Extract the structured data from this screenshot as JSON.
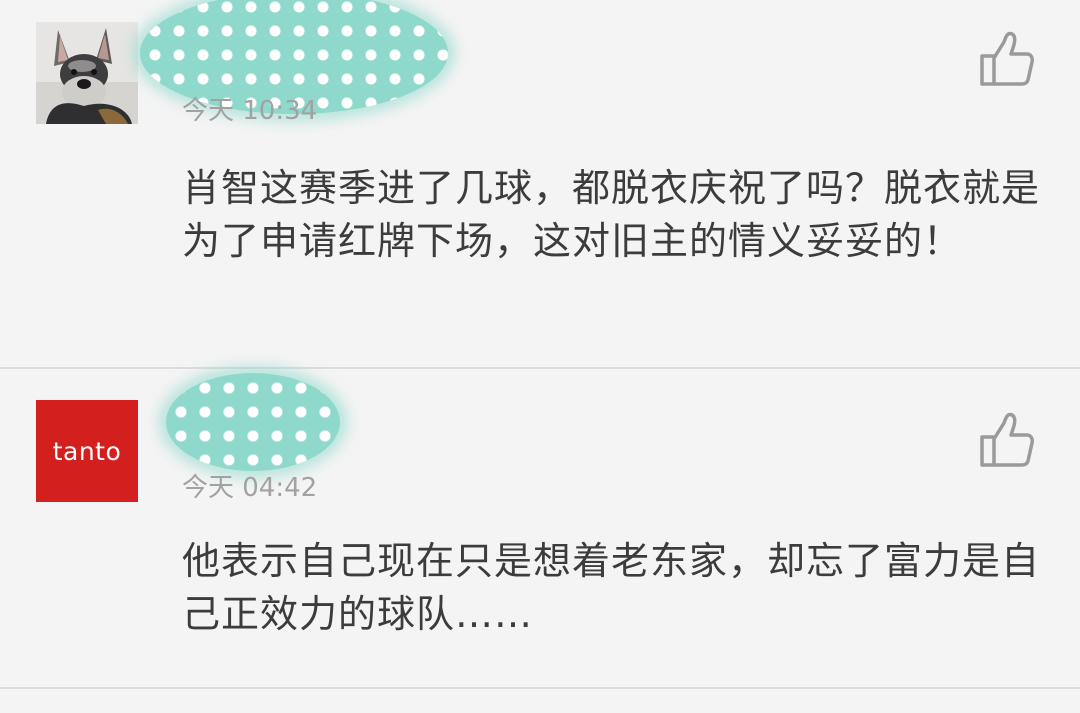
{
  "comments": [
    {
      "time": "今天 10:34",
      "body": "肖智这赛季进了几球，都脱衣庆祝了吗？脱衣就是为了申请红牌下场，这对旧主的情义妥妥的！"
    },
    {
      "avatar_text": "tanto",
      "time": "今天 04:42",
      "body": "他表示自己现在只是想着老东家，却忘了富力是自己正效力的球队……"
    }
  ],
  "colors": {
    "brand_red": "#d3201f",
    "mask_teal": "#8fd9cc",
    "text_primary": "#3c3c3c",
    "text_secondary": "#a2a2a2",
    "icon_gray": "#9a9a9a"
  },
  "icons": [
    "thumbs-up-icon"
  ]
}
